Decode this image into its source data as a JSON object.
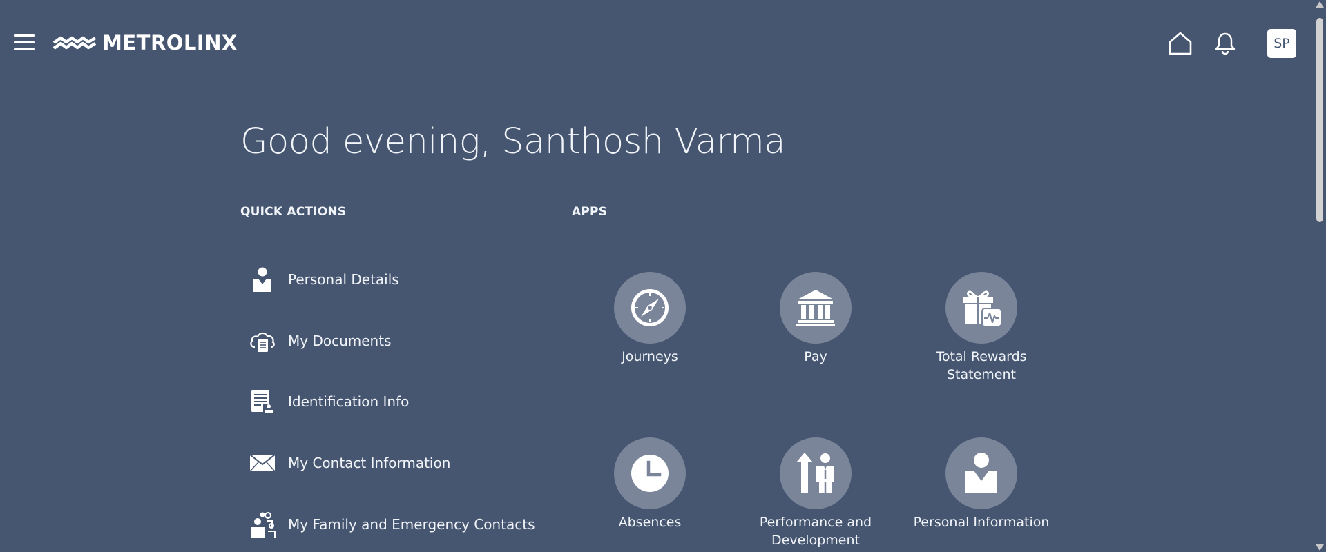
{
  "header": {
    "logo_text": "METROLINX",
    "avatar_initials": "SP"
  },
  "greeting": "Good evening, Santhosh Varma",
  "quick_actions": {
    "title": "QUICK ACTIONS",
    "items": [
      {
        "label": "Personal Details",
        "icon": "person-icon"
      },
      {
        "label": "My Documents",
        "icon": "cloud-document-icon"
      },
      {
        "label": "Identification Info",
        "icon": "id-document-icon"
      },
      {
        "label": "My Contact Information",
        "icon": "envelope-icon"
      },
      {
        "label": "My Family and Emergency Contacts",
        "icon": "family-icon"
      }
    ]
  },
  "apps": {
    "title": "APPS",
    "items": [
      {
        "label": "Journeys",
        "icon": "compass-icon"
      },
      {
        "label": "Pay",
        "icon": "bank-icon"
      },
      {
        "label": "Total Rewards Statement",
        "icon": "gift-icon"
      },
      {
        "label": "Absences",
        "icon": "clock-icon"
      },
      {
        "label": "Performance and Development",
        "icon": "growth-icon"
      },
      {
        "label": "Personal Information",
        "icon": "person-icon"
      }
    ]
  },
  "colors": {
    "background": "#465671",
    "app_circle": "#7a8599",
    "text": "#f1f4f8"
  }
}
